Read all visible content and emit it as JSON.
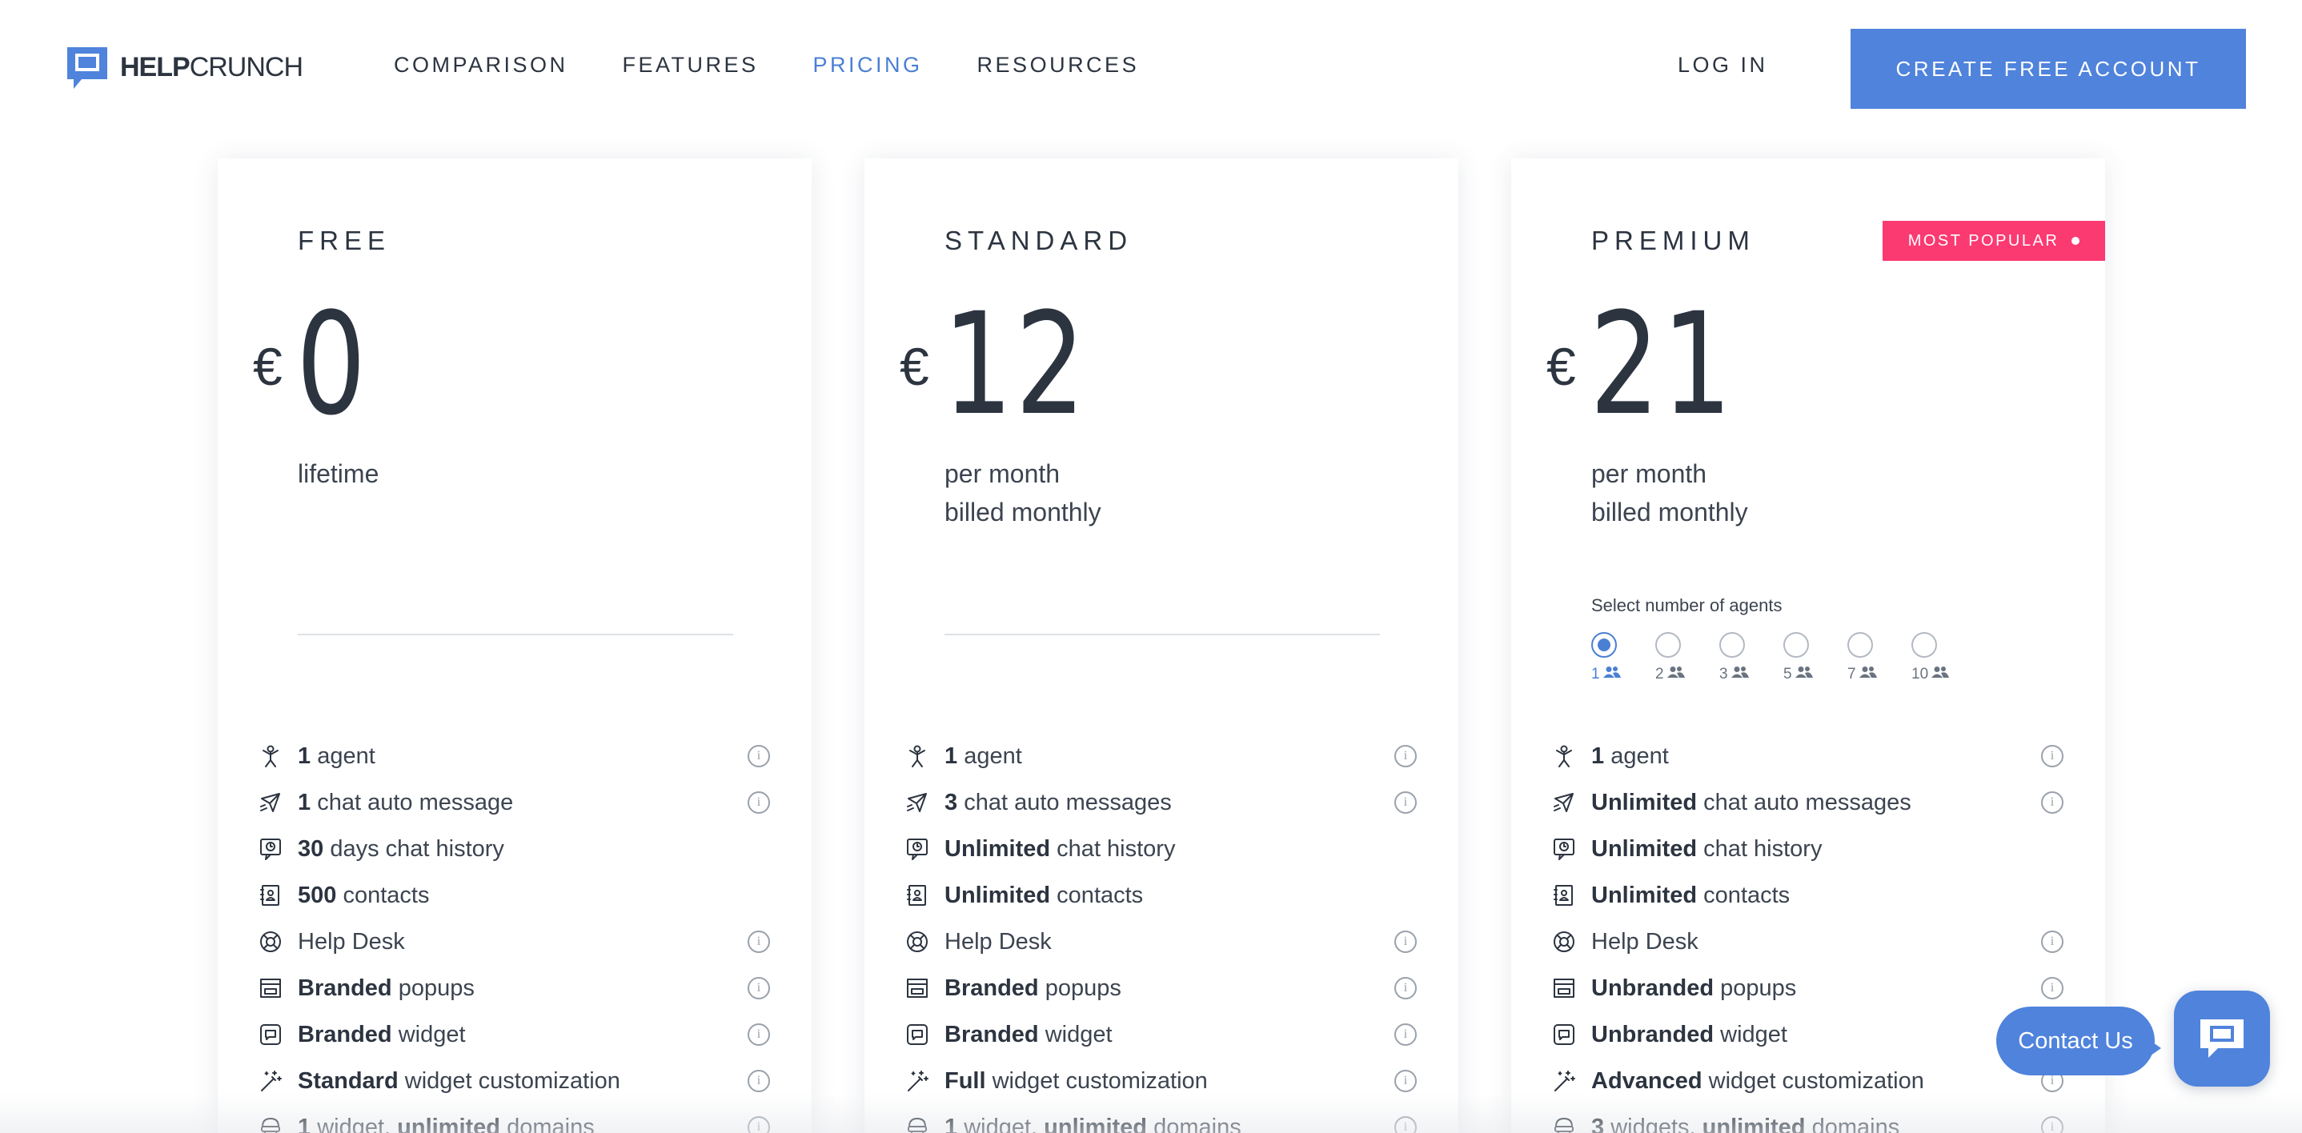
{
  "header": {
    "logo_bold": "HELP",
    "logo_rest": "CRUNCH",
    "nav": [
      "COMPARISON",
      "FEATURES",
      "PRICING",
      "RESOURCES"
    ],
    "active_nav": "PRICING",
    "login": "LOG IN",
    "cta": "CREATE FREE ACCOUNT"
  },
  "colors": {
    "accent": "#4f83dc",
    "badge": "#fb3a72",
    "text": "#2c3440"
  },
  "plans": [
    {
      "name": "FREE",
      "currency": "€",
      "price": "0",
      "period": [
        "lifetime"
      ],
      "features": [
        {
          "icon": "agent-icon",
          "bold": "1",
          "rest": " agent",
          "info": true
        },
        {
          "icon": "auto-message-icon",
          "bold": "1",
          "rest": " chat auto message",
          "info": true
        },
        {
          "icon": "chat-history-icon",
          "bold": "30",
          "rest": " days chat history",
          "info": false
        },
        {
          "icon": "contacts-icon",
          "bold": "500",
          "rest": " contacts",
          "info": false
        },
        {
          "icon": "help-desk-icon",
          "bold": "",
          "rest": "Help Desk",
          "info": true
        },
        {
          "icon": "popup-icon",
          "bold": "Branded",
          "rest": " popups",
          "info": true
        },
        {
          "icon": "widget-icon",
          "bold": "Branded",
          "rest": " widget",
          "info": true
        },
        {
          "icon": "magic-wand-icon",
          "bold": "Standard",
          "rest": " widget customization",
          "info": true
        },
        {
          "icon": "domains-icon",
          "bold": "1",
          "rest": " widget, ",
          "bold2": "unlimited",
          "rest2": " domains",
          "info": true
        }
      ]
    },
    {
      "name": "STANDARD",
      "currency": "€",
      "price": "12",
      "period": [
        "per month",
        "billed monthly"
      ],
      "features": [
        {
          "icon": "agent-icon",
          "bold": "1",
          "rest": " agent",
          "info": true
        },
        {
          "icon": "auto-message-icon",
          "bold": "3",
          "rest": " chat auto messages",
          "info": true
        },
        {
          "icon": "chat-history-icon",
          "bold": "Unlimited",
          "rest": " chat history",
          "info": false
        },
        {
          "icon": "contacts-icon",
          "bold": "Unlimited",
          "rest": " contacts",
          "info": false
        },
        {
          "icon": "help-desk-icon",
          "bold": "",
          "rest": "Help Desk",
          "info": true
        },
        {
          "icon": "popup-icon",
          "bold": "Branded",
          "rest": " popups",
          "info": true
        },
        {
          "icon": "widget-icon",
          "bold": "Branded",
          "rest": " widget",
          "info": true
        },
        {
          "icon": "magic-wand-icon",
          "bold": "Full",
          "rest": " widget customization",
          "info": true
        },
        {
          "icon": "domains-icon",
          "bold": "1",
          "rest": " widget, ",
          "bold2": "unlimited",
          "rest2": " domains",
          "info": true
        }
      ]
    },
    {
      "name": "PREMIUM",
      "currency": "€",
      "price": "21",
      "badge": "MOST POPULAR",
      "period": [
        "per month",
        "billed monthly"
      ],
      "agents_label": "Select number of agents",
      "agent_options": [
        "1",
        "2",
        "3",
        "5",
        "7",
        "10"
      ],
      "selected_agents": "1",
      "features": [
        {
          "icon": "agent-icon",
          "bold": "1",
          "rest": " agent",
          "info": true
        },
        {
          "icon": "auto-message-icon",
          "bold": "Unlimited",
          "rest": " chat auto messages",
          "info": true
        },
        {
          "icon": "chat-history-icon",
          "bold": "Unlimited",
          "rest": " chat history",
          "info": false
        },
        {
          "icon": "contacts-icon",
          "bold": "Unlimited",
          "rest": " contacts",
          "info": false
        },
        {
          "icon": "help-desk-icon",
          "bold": "",
          "rest": "Help Desk",
          "info": true
        },
        {
          "icon": "popup-icon",
          "bold": "Unbranded",
          "rest": " popups",
          "info": true
        },
        {
          "icon": "widget-icon",
          "bold": "Unbranded",
          "rest": " widget",
          "info": true
        },
        {
          "icon": "magic-wand-icon",
          "bold": "Advanced",
          "rest": " widget customization",
          "info": true
        },
        {
          "icon": "domains-icon",
          "bold": "3",
          "rest": " widgets, ",
          "bold2": "unlimited",
          "rest2": " domains",
          "info": true
        }
      ]
    }
  ],
  "contact": {
    "label": "Contact Us"
  }
}
